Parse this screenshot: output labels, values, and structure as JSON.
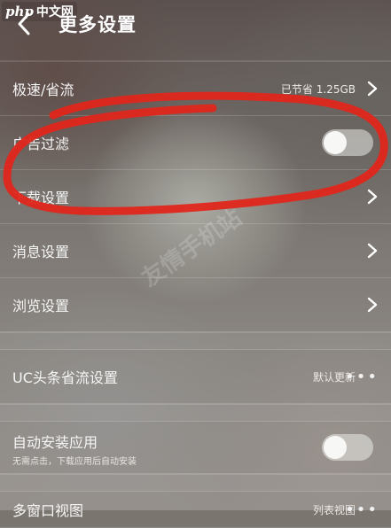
{
  "logo": {
    "php": "php",
    "cn": "中文网"
  },
  "header": {
    "title": "更多设置"
  },
  "rows": [
    {
      "label": "极速/省流",
      "value": "已节省 1.25GB"
    },
    {
      "label": "广告过滤"
    },
    {
      "label": "下载设置"
    },
    {
      "label": "消息设置"
    },
    {
      "label": "浏览设置"
    },
    {
      "label": "UC头条省流设置",
      "value": "默认更新"
    },
    {
      "label": "自动安装应用",
      "sub": "无需点击，下载应用后自动安装"
    },
    {
      "label": "多窗口视图",
      "value": "列表视图"
    }
  ],
  "watermark": {
    "text": "友情手机站"
  },
  "colors": {
    "annotation": "#e0261b"
  },
  "icons": [
    "chevron-left-icon",
    "chevron-right-icon",
    "more-dots-icon",
    "toggle-switch"
  ]
}
